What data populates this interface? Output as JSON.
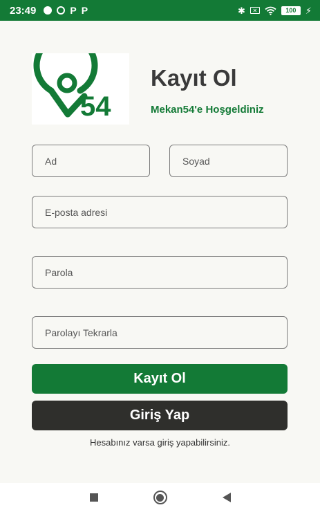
{
  "status_bar": {
    "time": "23:49",
    "notification_letters": [
      "P",
      "P"
    ],
    "battery_level": "100",
    "colors": {
      "background": "#137a36"
    }
  },
  "header": {
    "logo_text": "54",
    "title": "Kayıt Ol",
    "subtitle": "Mekan54'e Hoşgeldiniz"
  },
  "form": {
    "first_name_placeholder": "Ad",
    "last_name_placeholder": "Soyad",
    "email_placeholder": "E-posta adresi",
    "password_placeholder": "Parola",
    "password_repeat_placeholder": "Parolayı Tekrarla"
  },
  "buttons": {
    "register_label": "Kayıt Ol",
    "login_label": "Giriş Yap"
  },
  "hint": "Hesabınız varsa giriş yapabilirsiniz.",
  "colors": {
    "accent": "#137a36",
    "dark_button": "#2f2f2c",
    "background": "#f8f8f4"
  }
}
